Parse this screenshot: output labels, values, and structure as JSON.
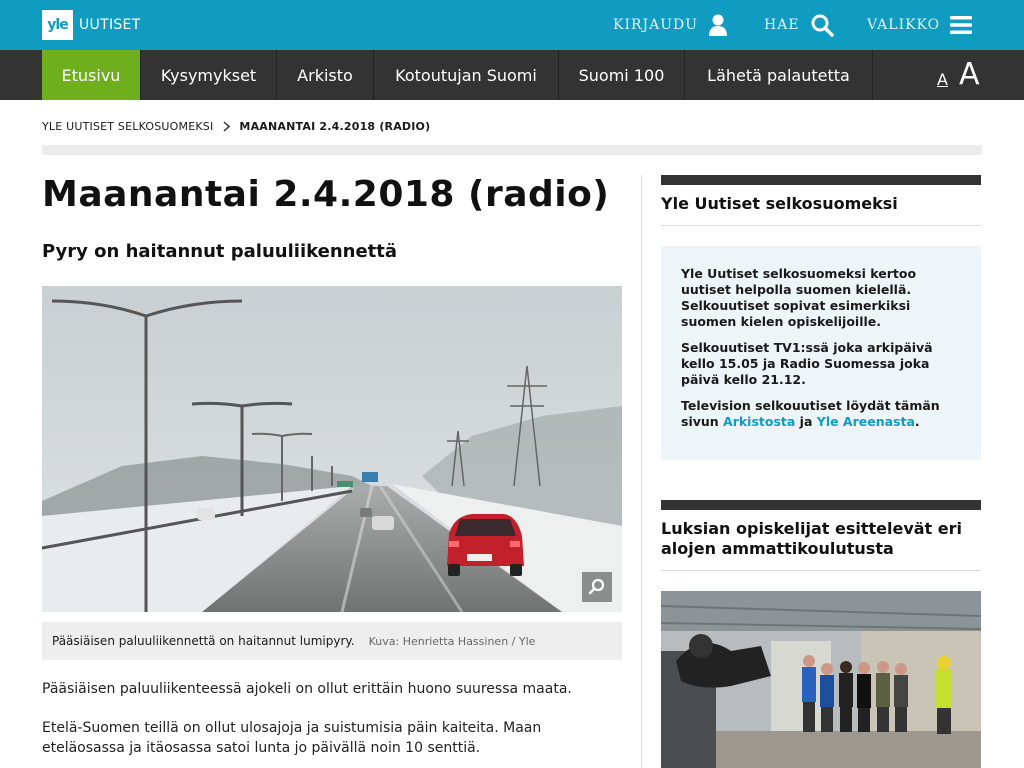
{
  "header": {
    "logo_mark": "yle",
    "logo_text": "UUTISET",
    "login_label": "KIRJAUDU",
    "search_label": "HAE",
    "menu_label": "VALIKKO",
    "color": "#0f9cc0"
  },
  "nav": {
    "items": [
      {
        "label": "Etusivu",
        "active": true
      },
      {
        "label": "Kysymykset",
        "active": false
      },
      {
        "label": "Arkisto",
        "active": false
      },
      {
        "label": "Kotoutujan Suomi",
        "active": false
      },
      {
        "label": "Suomi 100",
        "active": false
      },
      {
        "label": "Lähetä palautetta",
        "active": false
      }
    ],
    "font_small": "A",
    "font_large": "A",
    "active_color": "#6fae1c"
  },
  "breadcrumb": {
    "root": "YLE UUTISET SELKOSUOMEKSI",
    "current": "MAANANTAI 2.4.2018 (RADIO)"
  },
  "article": {
    "title": "Maanantai 2.4.2018 (radio)",
    "subtitle": "Pyry on haitannut paluuliikennettä",
    "image_caption": "Pääsiäisen paluuliikennettä on haitannut lumipyry.",
    "image_credit": "Kuva: Henrietta Hassinen / Yle",
    "paragraphs": [
      "Pääsiäisen paluuliikenteessä ajokeli on ollut erittäin huono suuressa maata.",
      "Etelä-Suomen teillä on ollut ulosajoja ja suistumisia päin kaiteita. Maan eteläosassa ja itäosassa satoi lunta jo päivällä noin 10 senttiä."
    ]
  },
  "sidebar": {
    "box_title": "Yle Uutiset selkosuomeksi",
    "info": {
      "p1": "Yle Uutiset selkosuomeksi kertoo uutiset helpolla suomen kielellä. Selkouutiset sopivat esimerkiksi suomen kielen opiskelijoille.",
      "p2": "Selkouutiset TV1:ssä joka arkipäivä kello 15.05 ja Radio Suomessa joka päivä kello 21.12.",
      "p3_start": "Television selkouutiset löydät tämän sivun ",
      "link1": "Arkistosta",
      "p3_mid": " ja ",
      "link2": "Yle Areenasta",
      "p3_end": "."
    },
    "story_title": "Luksian opiskelijat esittelevät eri alojen ammattikoulutusta"
  }
}
